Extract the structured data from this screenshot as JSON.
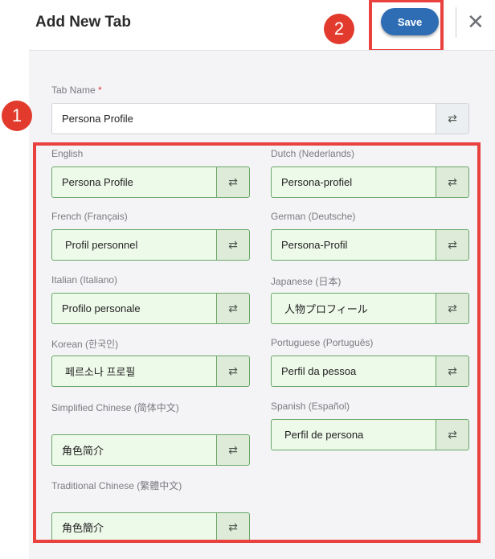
{
  "header": {
    "title": "Add New Tab",
    "save_label": "Save"
  },
  "badges": {
    "one": "1",
    "two": "2"
  },
  "tab_name": {
    "label": "Tab Name",
    "required_mark": "*",
    "value": "Persona Profile"
  },
  "languages": [
    {
      "label": "English",
      "value": "Persona Profile"
    },
    {
      "label": "Dutch (Nederlands)",
      "value": "Persona-profiel"
    },
    {
      "label": "French (Français)",
      "value": "Profil personnel"
    },
    {
      "label": "German (Deutsche)",
      "value": "Persona-Profil"
    },
    {
      "label": "Italian (Italiano)",
      "value": "Profilo personale"
    },
    {
      "label": "Japanese (日本)",
      "value": "人物プロフィール"
    },
    {
      "label": "Korean (한국인)",
      "value": "페르소나 프로필"
    },
    {
      "label": "Portuguese (Português)",
      "value": "Perfil da pessoa"
    },
    {
      "label": "Simplified Chinese (简体中文)",
      "value": "角色简介"
    },
    {
      "label": "Spanish (Español)",
      "value": "Perfil de persona"
    },
    {
      "label": "Traditional Chinese (繁體中文)",
      "value": "角色簡介"
    }
  ],
  "icons": {
    "translate": "translate-icon",
    "close": "close-icon"
  },
  "colors": {
    "primary": "#2e6db4",
    "highlight": "#e8413e",
    "field_green": "#edf9e9"
  }
}
